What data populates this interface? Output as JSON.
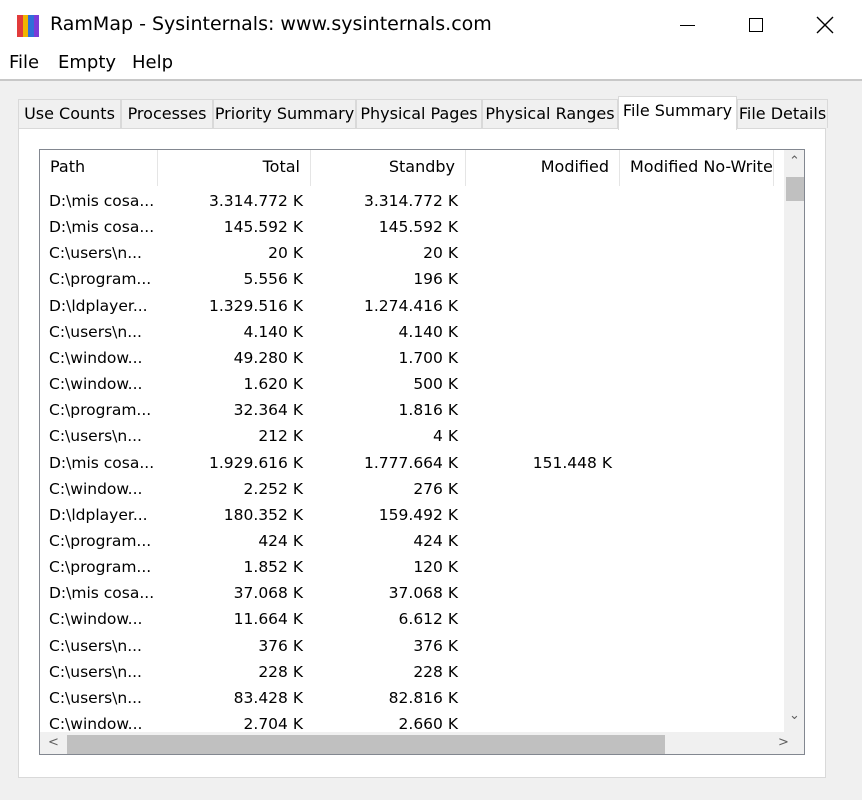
{
  "window": {
    "title": "RamMap - Sysinternals: www.sysinternals.com",
    "minimize": "–",
    "maximize": "☐",
    "close": "✕"
  },
  "menu": [
    "File",
    "Empty",
    "Help"
  ],
  "tabs": [
    {
      "label": "Use Counts",
      "active": false
    },
    {
      "label": "Processes",
      "active": false
    },
    {
      "label": "Priority Summary",
      "active": false
    },
    {
      "label": "Physical Pages",
      "active": false
    },
    {
      "label": "Physical Ranges",
      "active": false
    },
    {
      "label": "File Summary",
      "active": true
    },
    {
      "label": "File Details",
      "active": false
    }
  ],
  "columns": [
    "Path",
    "Total",
    "Standby",
    "Modified",
    "Modified No-Write"
  ],
  "rows": [
    [
      "D:\\mis cosa...",
      "3.314.772 K",
      "3.314.772 K",
      "",
      ""
    ],
    [
      "D:\\mis cosa...",
      "145.592 K",
      "145.592 K",
      "",
      ""
    ],
    [
      "C:\\users\\n...",
      "20 K",
      "20 K",
      "",
      ""
    ],
    [
      "C:\\program...",
      "5.556 K",
      "196 K",
      "",
      ""
    ],
    [
      "D:\\ldplayer...",
      "1.329.516 K",
      "1.274.416 K",
      "",
      ""
    ],
    [
      "C:\\users\\n...",
      "4.140 K",
      "4.140 K",
      "",
      ""
    ],
    [
      "C:\\window...",
      "49.280 K",
      "1.700 K",
      "",
      ""
    ],
    [
      "C:\\window...",
      "1.620 K",
      "500 K",
      "",
      ""
    ],
    [
      "C:\\program...",
      "32.364 K",
      "1.816 K",
      "",
      ""
    ],
    [
      "C:\\users\\n...",
      "212 K",
      "4 K",
      "",
      ""
    ],
    [
      "D:\\mis cosa...",
      "1.929.616 K",
      "1.777.664 K",
      "151.448 K",
      ""
    ],
    [
      "C:\\window...",
      "2.252 K",
      "276 K",
      "",
      ""
    ],
    [
      "D:\\ldplayer...",
      "180.352 K",
      "159.492 K",
      "",
      ""
    ],
    [
      "C:\\program...",
      "424 K",
      "424 K",
      "",
      ""
    ],
    [
      "C:\\program...",
      "1.852 K",
      "120 K",
      "",
      ""
    ],
    [
      "D:\\mis cosa...",
      "37.068 K",
      "37.068 K",
      "",
      ""
    ],
    [
      "C:\\window...",
      "11.664 K",
      "6.612 K",
      "",
      ""
    ],
    [
      "C:\\users\\n...",
      "376 K",
      "376 K",
      "",
      ""
    ],
    [
      "C:\\users\\n...",
      "228 K",
      "228 K",
      "",
      ""
    ],
    [
      "C:\\users\\n...",
      "83.428 K",
      "82.816 K",
      "",
      ""
    ],
    [
      "C:\\window...",
      "2.704 K",
      "2.660 K",
      "",
      ""
    ]
  ],
  "scroll": {
    "up": "⌃",
    "down": "⌄",
    "left": "<",
    "right": ">"
  }
}
